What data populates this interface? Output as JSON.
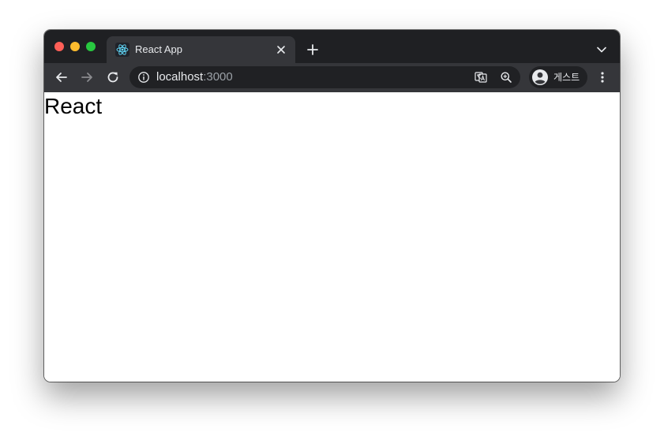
{
  "browser": {
    "tab": {
      "title": "React App",
      "favicon": "react-logo-icon"
    },
    "toolbar": {
      "back_icon": "arrow-left-icon",
      "forward_icon": "arrow-right-icon",
      "reload_icon": "reload-icon"
    },
    "omnibox": {
      "host": "localhost",
      "port": ":3000",
      "site_info_icon": "info-icon",
      "translate_icon": "translate-icon",
      "zoom_icon": "zoom-in-icon"
    },
    "profile": {
      "name": "게스트",
      "avatar_icon": "account-circle-icon"
    },
    "colors": {
      "tabstrip": "#1f2023",
      "active_tab": "#35363a",
      "omnibox": "#202124",
      "text": "#e8eaed",
      "muted_text": "#9aa0a6"
    }
  },
  "page": {
    "heading": "React"
  }
}
